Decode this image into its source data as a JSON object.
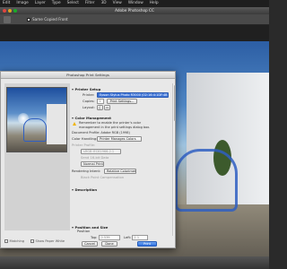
{
  "menubar": {
    "items": [
      "Edit",
      "Image",
      "Layer",
      "Type",
      "Select",
      "Filter",
      "3D",
      "View",
      "Window",
      "Help"
    ]
  },
  "app": {
    "title": "Adobe Photoshop CC",
    "options_checkbox_label": "Same Copied Front"
  },
  "dialog": {
    "title": "Photoshop Print Settings",
    "printer_setup": {
      "heading": "Printer Setup",
      "printer_label": "Printer:",
      "printer_value": "Epson Stylus Photo R3000 (02:16:4:1DF:4B)",
      "copies_label": "Copies:",
      "copies_value": "1",
      "print_settings_button": "Print Settings...",
      "layout_label": "Layout:"
    },
    "color_management": {
      "heading": "Color Management",
      "note_line1": "Remember to enable the printer's color",
      "note_line2": "management in the print settings dialog box.",
      "document_profile": "Document Profile: Adobe RGB (1998)",
      "color_handling_label": "Color Handling:",
      "color_handling_value": "Printer Manages Colors",
      "printer_profile_label": "Printer Profile:",
      "printer_profile_value": "sRGB IEC61966-2.1",
      "send_16bit_label": "Send 16-bit Data",
      "normal_printing_value": "Normal Printing",
      "rendering_intent_label": "Rendering Intent:",
      "rendering_intent_value": "Relative Colorimetric",
      "black_point_label": "Black Point Compensation"
    },
    "description": {
      "heading": "Description"
    },
    "position_size": {
      "heading": "Position and Size",
      "position_label": "Position",
      "top_label": "Top:",
      "top_value": "0.539",
      "left_label": "Left:",
      "left_value": "1.1"
    },
    "bottom": {
      "match_colors_label": "Matching",
      "show_paper_white_label": "Show Paper White",
      "cancel_button": "Cancel",
      "done_button": "Done",
      "print_button": "Print"
    }
  },
  "colors": {
    "accent": "#3d73d6",
    "warning": "#f0b400"
  }
}
